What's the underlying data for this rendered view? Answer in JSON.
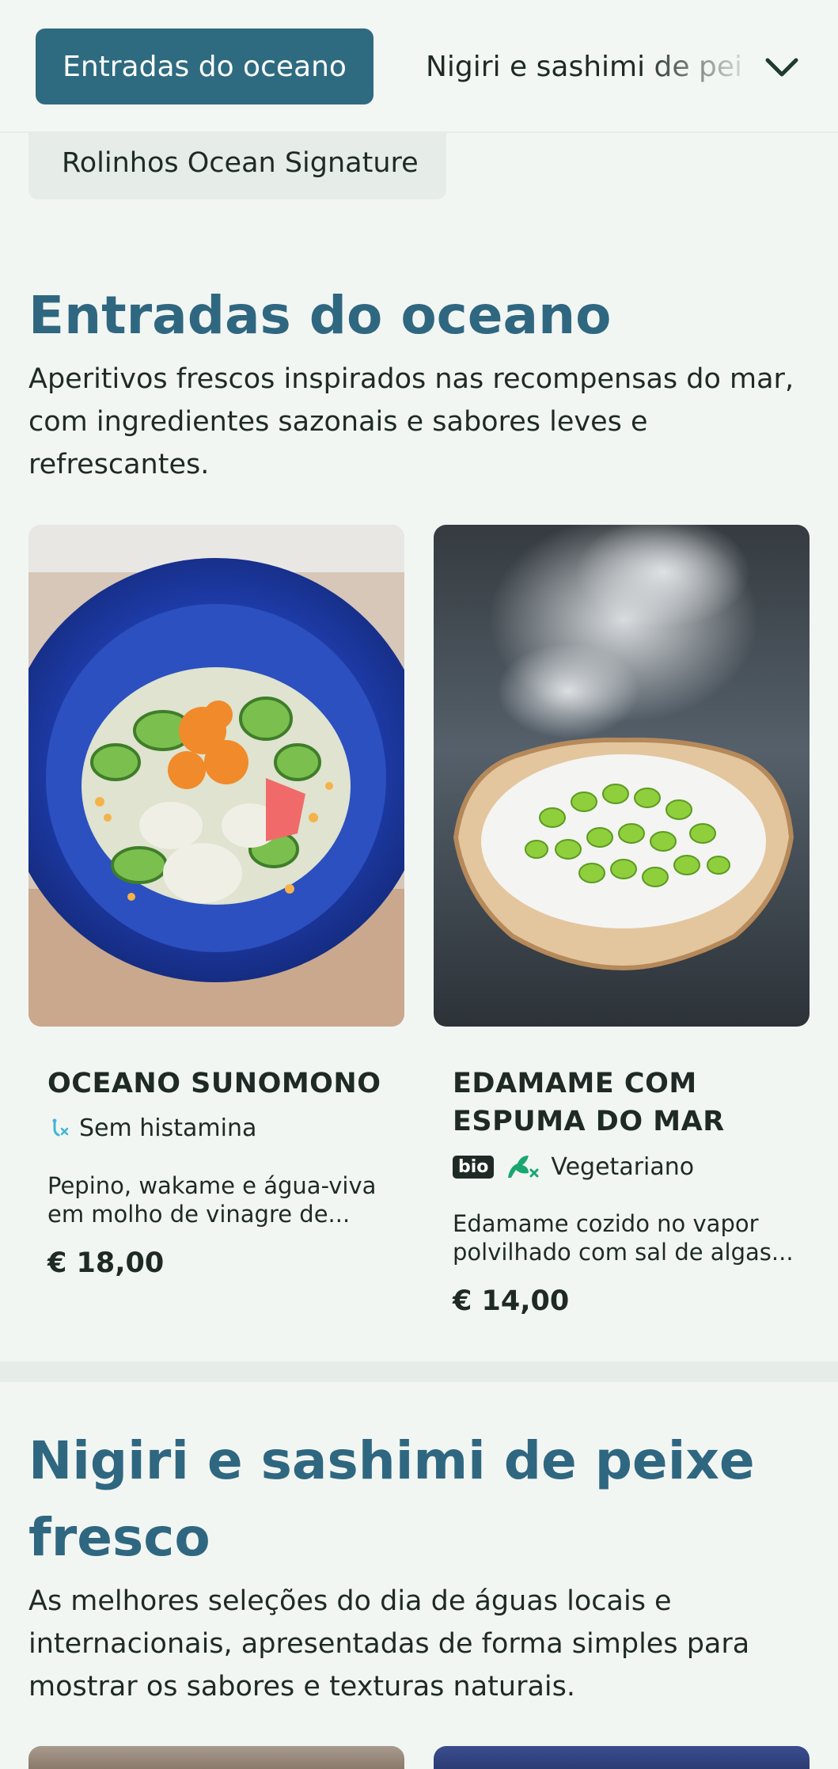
{
  "nav": {
    "active_tab": "Entradas do oceano",
    "next_tab": "Nigiri e sashimi de peixe fresco",
    "secondary_item": "Rolinhos Ocean Signature"
  },
  "sections": [
    {
      "title": "Entradas do oceano",
      "description": "Aperitivos frescos inspirados nas recompensas do mar, com ingredientes sazonais e sabores leves e refrescantes.",
      "items": [
        {
          "name": "OCEANO SUNOMONO",
          "tags": [
            "Sem histamina"
          ],
          "description_line1": "Pepino, wakame e água-viva",
          "description_line2": "em molho de vinagre de...",
          "price": "€ 18,00"
        },
        {
          "name_line1": "EDAMAME COM",
          "name_line2": "ESPUMA DO MAR",
          "badge": "bio",
          "tags": [
            "Vegetariano"
          ],
          "description_line1": "Edamame cozido no vapor",
          "description_line2": "polvilhado com sal de algas...",
          "price": "€ 14,00"
        }
      ]
    },
    {
      "title_line1": "Nigiri e sashimi de peixe",
      "title_line2": "fresco",
      "description": "As melhores seleções do dia de águas locais e internacionais, apresentadas de forma simples para mostrar os sabores e texturas naturais."
    }
  ],
  "colors": {
    "accent": "#2e6b80",
    "heading": "#2f6780",
    "background": "#f2f6f3",
    "veg_icon": "#1aa66f",
    "histamine_icon": "#3fb6d6"
  },
  "icons": [
    "chevron-down-icon",
    "histamine-free-icon",
    "vegetarian-icon"
  ]
}
